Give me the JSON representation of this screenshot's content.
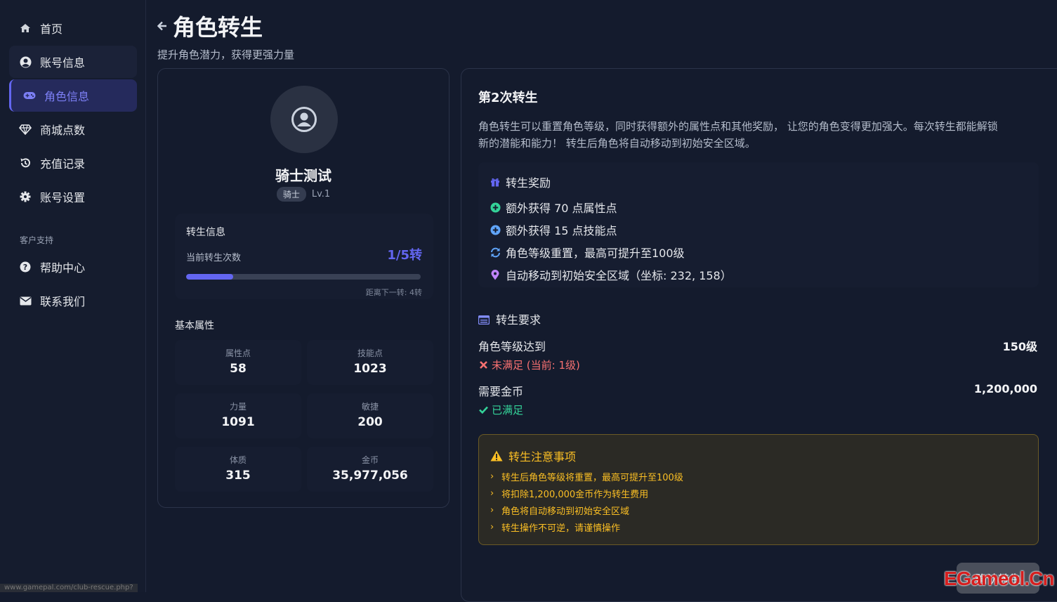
{
  "sidebar": {
    "items": [
      {
        "label": "首页",
        "icon": "home-icon"
      },
      {
        "label": "账号信息",
        "icon": "user-circle-icon"
      },
      {
        "label": "角色信息",
        "icon": "gamepad-icon"
      },
      {
        "label": "商城点数",
        "icon": "diamond-icon"
      },
      {
        "label": "充值记录",
        "icon": "history-icon"
      },
      {
        "label": "账号设置",
        "icon": "gear-icon"
      }
    ],
    "support_section": "客户支持",
    "support_items": [
      {
        "label": "帮助中心",
        "icon": "question-circle-icon"
      },
      {
        "label": "联系我们",
        "icon": "envelope-icon"
      }
    ]
  },
  "header": {
    "title": "角色转生",
    "subtitle": "提升角色潜力，获得更强力量"
  },
  "character": {
    "name": "骑士测试",
    "class": "骑士",
    "level": "Lv.1",
    "rebirth": {
      "title": "转生信息",
      "label": "当前转生次数",
      "value": "1/5转",
      "progress": 0.2,
      "next": "距离下一转: 4转"
    },
    "attributes_title": "基本属性",
    "attributes": [
      {
        "label": "属性点",
        "value": "58"
      },
      {
        "label": "技能点",
        "value": "1023"
      },
      {
        "label": "力量",
        "value": "1091"
      },
      {
        "label": "敏捷",
        "value": "200"
      },
      {
        "label": "体质",
        "value": "315"
      },
      {
        "label": "金币",
        "value": "35,977,056"
      }
    ]
  },
  "rebirth_panel": {
    "title": "第2次转生",
    "desc_line1": "角色转生可以重置角色等级，同时获得额外的属性点和其他奖励， 让您的角色变得更加强大。每次转生都能解锁",
    "desc_line2": "新的潜能和能力！ 转生后角色将自动移动到初始安全区域。",
    "rewards_title": "转生奖励",
    "rewards": [
      "额外获得 70 点属性点",
      "额外获得 15 点技能点",
      "角色等级重置，最高可提升至100级",
      "自动移动到初始安全区域（坐标: 232, 158）"
    ],
    "requirements_title": "转生要求",
    "requirements": [
      {
        "label": "角色等级达到",
        "value": "150级",
        "status": "未满足 (当前: 1级)",
        "met": false
      },
      {
        "label": "需要金币",
        "value": "1,200,000",
        "status": "已满足",
        "met": true
      }
    ],
    "notice_title": "转生注意事项",
    "notices": [
      "转生后角色等级将重置，最高可提升至100级",
      "将扣除1,200,000金币作为转生费用",
      "角色将自动移动到初始安全区域",
      "转生操作不可逆，请谨慎操作"
    ],
    "confirm_label": "确认转生"
  },
  "status_url": "www.gamepal.com/club-rescue.php?",
  "watermark": "EGameol.Cn",
  "colors": {
    "accent": "#6366f1",
    "success": "#34d399",
    "danger": "#f87171",
    "warning": "#fbbf24"
  }
}
